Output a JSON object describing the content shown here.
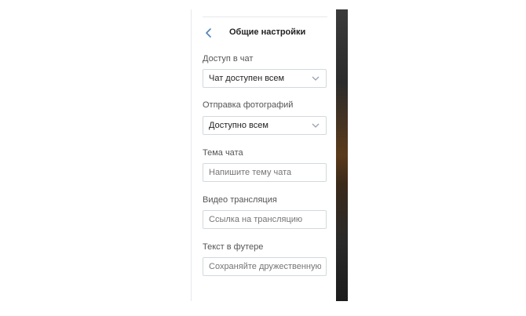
{
  "header": {
    "title": "Общие настройки",
    "back_icon": "chevron-left-icon"
  },
  "fields": [
    {
      "label": "Доступ в чат",
      "kind": "select",
      "value": "Чат доступен всем"
    },
    {
      "label": "Отправка фотографий",
      "kind": "select",
      "value": "Доступно всем"
    },
    {
      "label": "Тема чата",
      "kind": "input",
      "placeholder": "Напишите тему чата"
    },
    {
      "label": "Видео трансляция",
      "kind": "input",
      "placeholder": "Ссылка на трансляцию"
    },
    {
      "label": "Текст в футере",
      "kind": "input",
      "placeholder": "Сохраняйте дружественную атмосферу"
    }
  ],
  "colors": {
    "accent": "#5181b8",
    "border": "#d3d9de",
    "label": "#555555",
    "placeholder": "#8f97a0"
  }
}
